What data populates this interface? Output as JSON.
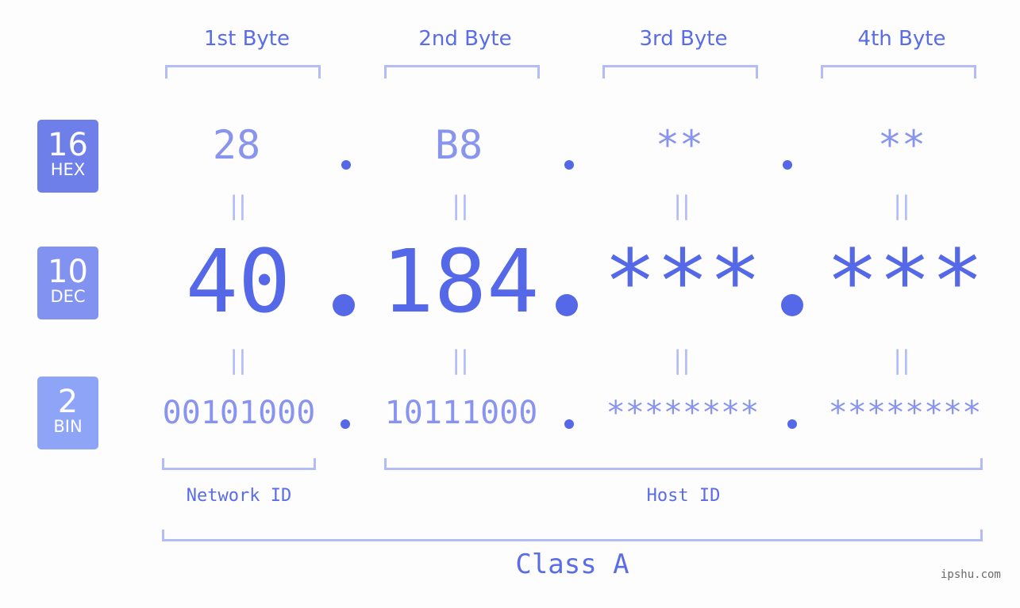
{
  "byte_headers": [
    "1st Byte",
    "2nd Byte",
    "3rd Byte",
    "4th Byte"
  ],
  "badges": [
    {
      "num": "16",
      "unit": "HEX",
      "color": "#6e7fe9"
    },
    {
      "num": "10",
      "unit": "DEC",
      "color": "#8192f0"
    },
    {
      "num": "2",
      "unit": "BIN",
      "color": "#8ea5f7"
    }
  ],
  "hex": [
    "28",
    "B8",
    "**",
    "**"
  ],
  "dec": [
    "40",
    "184",
    "***",
    "***"
  ],
  "bin": [
    "00101000",
    "10111000",
    "********",
    "********"
  ],
  "equals_symbol": "||",
  "network_label": "Network ID",
  "host_label": "Host ID",
  "class_label": "Class A",
  "watermark": "ipshu.com",
  "colors": {
    "accent": "#5568e8",
    "muted": "#8894ee",
    "bracket": "#b4bcf7"
  }
}
